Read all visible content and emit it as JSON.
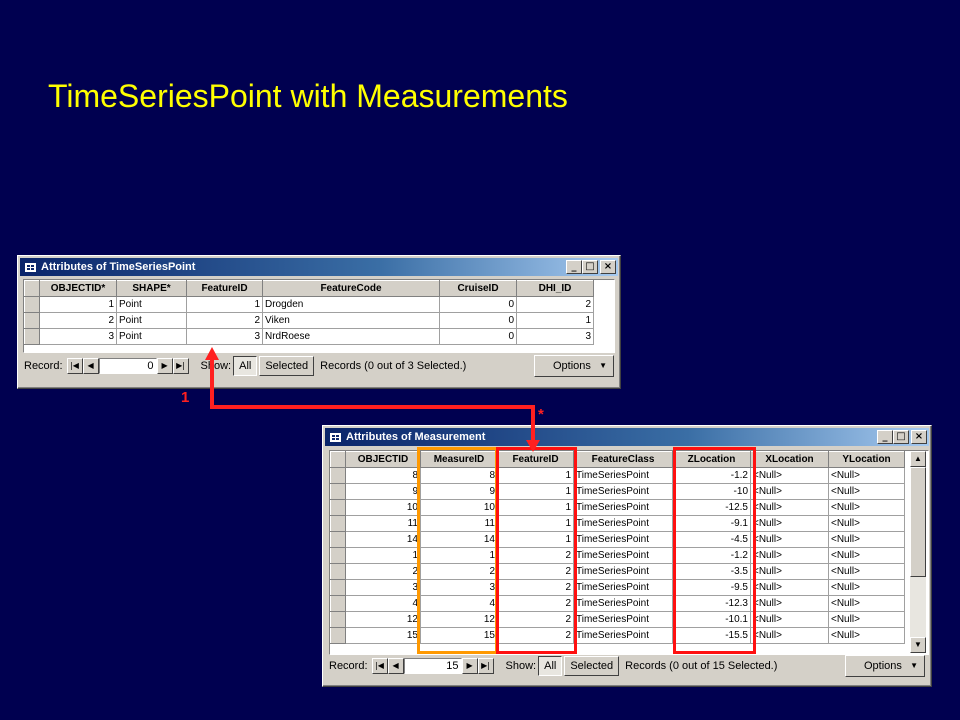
{
  "slide": {
    "title": "TimeSeriesPoint with Measurements"
  },
  "relationship": {
    "one_label": "1",
    "many_label": "*",
    "color": "#ff2020"
  },
  "window1": {
    "title": "Attributes of TimeSeriesPoint",
    "columns": [
      "OBJECTID*",
      "SHAPE*",
      "FeatureID",
      "FeatureCode",
      "CruiseID",
      "DHI_ID"
    ],
    "rows": [
      [
        "1",
        "Point",
        "1",
        "Drogden",
        "0",
        "2"
      ],
      [
        "2",
        "Point",
        "2",
        "Viken",
        "0",
        "1"
      ],
      [
        "3",
        "Point",
        "3",
        "NrdRoese",
        "0",
        "3"
      ]
    ],
    "nav": {
      "record_label": "Record:",
      "record_value": "0",
      "show_label": "Show:",
      "all_label": "All",
      "selected_label": "Selected",
      "records_text": "Records  (0 out of 3 Selected.)",
      "options_label": "Options"
    }
  },
  "window2": {
    "title": "Attributes of Measurement",
    "columns": [
      "OBJECTID",
      "MeasureID",
      "FeatureID",
      "FeatureClass",
      "ZLocation",
      "XLocation",
      "YLocation"
    ],
    "rows": [
      [
        "8",
        "8",
        "1",
        "TimeSeriesPoint",
        "-1.2",
        "<Null>",
        "<Null>"
      ],
      [
        "9",
        "9",
        "1",
        "TimeSeriesPoint",
        "-10",
        "<Null>",
        "<Null>"
      ],
      [
        "10",
        "10",
        "1",
        "TimeSeriesPoint",
        "-12.5",
        "<Null>",
        "<Null>"
      ],
      [
        "11",
        "11",
        "1",
        "TimeSeriesPoint",
        "-9.1",
        "<Null>",
        "<Null>"
      ],
      [
        "14",
        "14",
        "1",
        "TimeSeriesPoint",
        "-4.5",
        "<Null>",
        "<Null>"
      ],
      [
        "1",
        "1",
        "2",
        "TimeSeriesPoint",
        "-1.2",
        "<Null>",
        "<Null>"
      ],
      [
        "2",
        "2",
        "2",
        "TimeSeriesPoint",
        "-3.5",
        "<Null>",
        "<Null>"
      ],
      [
        "3",
        "3",
        "2",
        "TimeSeriesPoint",
        "-9.5",
        "<Null>",
        "<Null>"
      ],
      [
        "4",
        "4",
        "2",
        "TimeSeriesPoint",
        "-12.3",
        "<Null>",
        "<Null>"
      ],
      [
        "12",
        "12",
        "2",
        "TimeSeriesPoint",
        "-10.1",
        "<Null>",
        "<Null>"
      ],
      [
        "15",
        "15",
        "2",
        "TimeSeriesPoint",
        "-15.5",
        "<Null>",
        "<Null>"
      ]
    ],
    "nav": {
      "record_label": "Record:",
      "record_value": "15",
      "show_label": "Show:",
      "all_label": "All",
      "selected_label": "Selected",
      "records_text": "Records  (0 out of 15 Selected.)",
      "options_label": "Options"
    }
  },
  "highlight_colors": {
    "measureid": "#ff9900",
    "featureid": "#ff1010",
    "zlocation": "#ff1010"
  },
  "icons": {
    "minimize": "_",
    "maximize": "□",
    "close": "×",
    "first": "|◀",
    "prev": "◀",
    "next": "▶",
    "last": "▶|",
    "dropdown": "▼",
    "scroll_up": "▲",
    "scroll_down": "▼"
  }
}
